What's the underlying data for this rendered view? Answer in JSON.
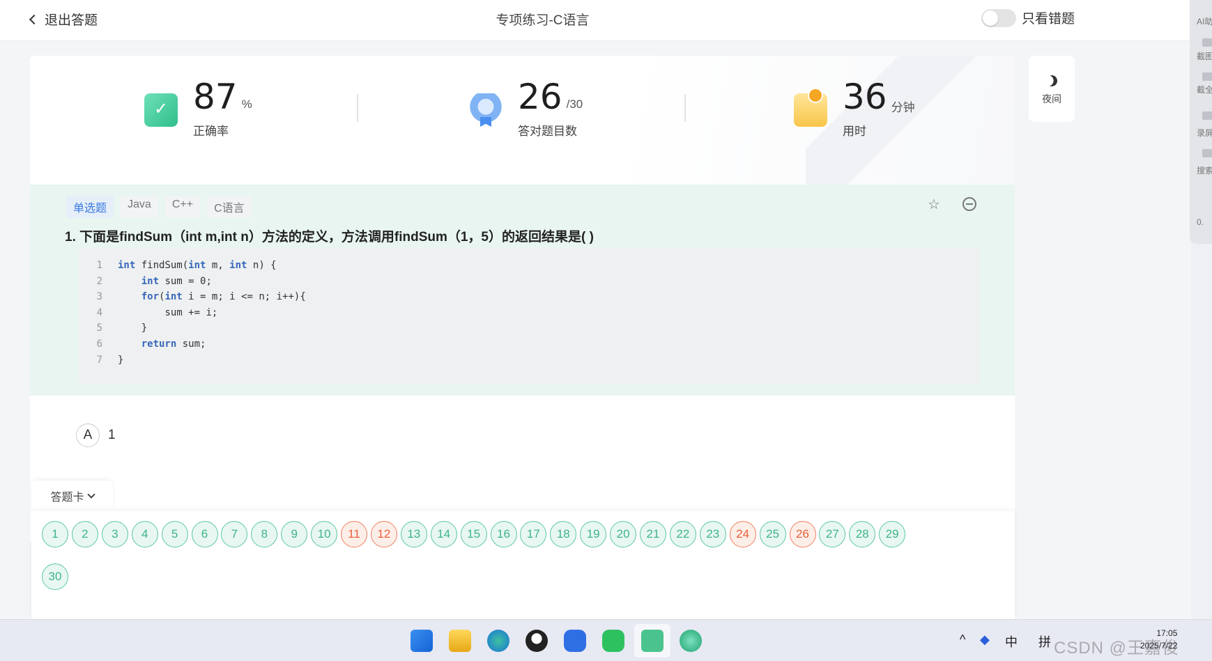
{
  "header": {
    "back_label": "退出答题",
    "title": "专项练习-C语言",
    "wrong_only_label": "只看错题"
  },
  "right_tools": {
    "labels": [
      "AI助",
      "截图",
      "截全",
      "录屏",
      "搜索"
    ],
    "value": "0."
  },
  "stats": [
    {
      "value": "87",
      "unit": "%",
      "label": "正确率"
    },
    {
      "value": "26",
      "unit": "/30",
      "label": "答对题目数"
    },
    {
      "value": "36",
      "unit": "分钟",
      "label": "用时"
    }
  ],
  "night_label": "夜间",
  "question": {
    "tags": [
      "单选题",
      "Java",
      "C++",
      "C语言"
    ],
    "text": "1. 下面是findSum（int m,int n）方法的定义，方法调用findSum（1，5）的返回结果是( )",
    "code_lines": [
      {
        "n": "1",
        "pre": "",
        "kw": "int",
        "rest": " findSum(",
        "kw2": "int",
        "rest2": " m, ",
        "kw3": "int",
        "rest3": " n) {"
      },
      {
        "n": "2",
        "pre": "    ",
        "kw": "int",
        "rest": " sum = 0;",
        "kw2": "",
        "rest2": "",
        "kw3": "",
        "rest3": ""
      },
      {
        "n": "3",
        "pre": "    ",
        "kw": "for",
        "rest": "(",
        "kw2": "int",
        "rest2": " i = m; i <= n; i++){",
        "kw3": "",
        "rest3": ""
      },
      {
        "n": "4",
        "pre": "        ",
        "kw": "",
        "rest": "sum += i;",
        "kw2": "",
        "rest2": "",
        "kw3": "",
        "rest3": ""
      },
      {
        "n": "5",
        "pre": "    ",
        "kw": "",
        "rest": "}",
        "kw2": "",
        "rest2": "",
        "kw3": "",
        "rest3": ""
      },
      {
        "n": "6",
        "pre": "    ",
        "kw": "return",
        "rest": " sum;",
        "kw2": "",
        "rest2": "",
        "kw3": "",
        "rest3": ""
      },
      {
        "n": "7",
        "pre": "",
        "kw": "",
        "rest": "}",
        "kw2": "",
        "rest2": "",
        "kw3": "",
        "rest3": ""
      }
    ]
  },
  "options": [
    {
      "letter": "A",
      "text": "1"
    }
  ],
  "answer_card": {
    "label": "答题卡",
    "numbers": [
      "1",
      "2",
      "3",
      "4",
      "5",
      "6",
      "7",
      "8",
      "9",
      "10",
      "11",
      "12",
      "13",
      "14",
      "15",
      "16",
      "17",
      "18",
      "19",
      "20",
      "21",
      "22",
      "23",
      "24",
      "25",
      "26",
      "27",
      "28",
      "29",
      "30"
    ],
    "wrong": [
      "11",
      "12",
      "24",
      "26"
    ]
  },
  "taskbar": {
    "ime_lang": "中",
    "ime_mode": "拼",
    "time": "17:05",
    "date": "2025/7/22",
    "watermark": "CSDN @王嘉俊"
  }
}
